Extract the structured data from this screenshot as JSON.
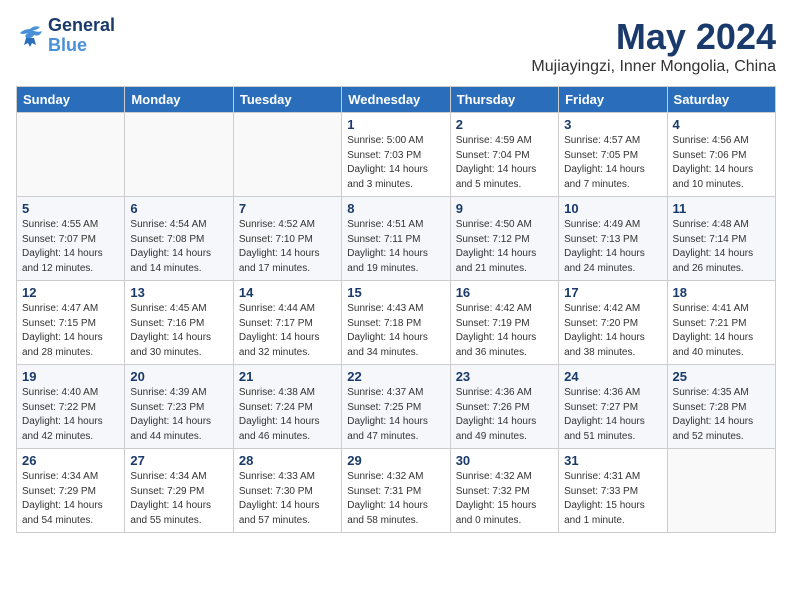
{
  "logo": {
    "line1": "General",
    "line2": "Blue"
  },
  "title": "May 2024",
  "subtitle": "Mujiayingzi, Inner Mongolia, China",
  "weekdays": [
    "Sunday",
    "Monday",
    "Tuesday",
    "Wednesday",
    "Thursday",
    "Friday",
    "Saturday"
  ],
  "rows": [
    [
      {
        "day": "",
        "info": ""
      },
      {
        "day": "",
        "info": ""
      },
      {
        "day": "",
        "info": ""
      },
      {
        "day": "1",
        "info": "Sunrise: 5:00 AM\nSunset: 7:03 PM\nDaylight: 14 hours\nand 3 minutes."
      },
      {
        "day": "2",
        "info": "Sunrise: 4:59 AM\nSunset: 7:04 PM\nDaylight: 14 hours\nand 5 minutes."
      },
      {
        "day": "3",
        "info": "Sunrise: 4:57 AM\nSunset: 7:05 PM\nDaylight: 14 hours\nand 7 minutes."
      },
      {
        "day": "4",
        "info": "Sunrise: 4:56 AM\nSunset: 7:06 PM\nDaylight: 14 hours\nand 10 minutes."
      }
    ],
    [
      {
        "day": "5",
        "info": "Sunrise: 4:55 AM\nSunset: 7:07 PM\nDaylight: 14 hours\nand 12 minutes."
      },
      {
        "day": "6",
        "info": "Sunrise: 4:54 AM\nSunset: 7:08 PM\nDaylight: 14 hours\nand 14 minutes."
      },
      {
        "day": "7",
        "info": "Sunrise: 4:52 AM\nSunset: 7:10 PM\nDaylight: 14 hours\nand 17 minutes."
      },
      {
        "day": "8",
        "info": "Sunrise: 4:51 AM\nSunset: 7:11 PM\nDaylight: 14 hours\nand 19 minutes."
      },
      {
        "day": "9",
        "info": "Sunrise: 4:50 AM\nSunset: 7:12 PM\nDaylight: 14 hours\nand 21 minutes."
      },
      {
        "day": "10",
        "info": "Sunrise: 4:49 AM\nSunset: 7:13 PM\nDaylight: 14 hours\nand 24 minutes."
      },
      {
        "day": "11",
        "info": "Sunrise: 4:48 AM\nSunset: 7:14 PM\nDaylight: 14 hours\nand 26 minutes."
      }
    ],
    [
      {
        "day": "12",
        "info": "Sunrise: 4:47 AM\nSunset: 7:15 PM\nDaylight: 14 hours\nand 28 minutes."
      },
      {
        "day": "13",
        "info": "Sunrise: 4:45 AM\nSunset: 7:16 PM\nDaylight: 14 hours\nand 30 minutes."
      },
      {
        "day": "14",
        "info": "Sunrise: 4:44 AM\nSunset: 7:17 PM\nDaylight: 14 hours\nand 32 minutes."
      },
      {
        "day": "15",
        "info": "Sunrise: 4:43 AM\nSunset: 7:18 PM\nDaylight: 14 hours\nand 34 minutes."
      },
      {
        "day": "16",
        "info": "Sunrise: 4:42 AM\nSunset: 7:19 PM\nDaylight: 14 hours\nand 36 minutes."
      },
      {
        "day": "17",
        "info": "Sunrise: 4:42 AM\nSunset: 7:20 PM\nDaylight: 14 hours\nand 38 minutes."
      },
      {
        "day": "18",
        "info": "Sunrise: 4:41 AM\nSunset: 7:21 PM\nDaylight: 14 hours\nand 40 minutes."
      }
    ],
    [
      {
        "day": "19",
        "info": "Sunrise: 4:40 AM\nSunset: 7:22 PM\nDaylight: 14 hours\nand 42 minutes."
      },
      {
        "day": "20",
        "info": "Sunrise: 4:39 AM\nSunset: 7:23 PM\nDaylight: 14 hours\nand 44 minutes."
      },
      {
        "day": "21",
        "info": "Sunrise: 4:38 AM\nSunset: 7:24 PM\nDaylight: 14 hours\nand 46 minutes."
      },
      {
        "day": "22",
        "info": "Sunrise: 4:37 AM\nSunset: 7:25 PM\nDaylight: 14 hours\nand 47 minutes."
      },
      {
        "day": "23",
        "info": "Sunrise: 4:36 AM\nSunset: 7:26 PM\nDaylight: 14 hours\nand 49 minutes."
      },
      {
        "day": "24",
        "info": "Sunrise: 4:36 AM\nSunset: 7:27 PM\nDaylight: 14 hours\nand 51 minutes."
      },
      {
        "day": "25",
        "info": "Sunrise: 4:35 AM\nSunset: 7:28 PM\nDaylight: 14 hours\nand 52 minutes."
      }
    ],
    [
      {
        "day": "26",
        "info": "Sunrise: 4:34 AM\nSunset: 7:29 PM\nDaylight: 14 hours\nand 54 minutes."
      },
      {
        "day": "27",
        "info": "Sunrise: 4:34 AM\nSunset: 7:29 PM\nDaylight: 14 hours\nand 55 minutes."
      },
      {
        "day": "28",
        "info": "Sunrise: 4:33 AM\nSunset: 7:30 PM\nDaylight: 14 hours\nand 57 minutes."
      },
      {
        "day": "29",
        "info": "Sunrise: 4:32 AM\nSunset: 7:31 PM\nDaylight: 14 hours\nand 58 minutes."
      },
      {
        "day": "30",
        "info": "Sunrise: 4:32 AM\nSunset: 7:32 PM\nDaylight: 15 hours\nand 0 minutes."
      },
      {
        "day": "31",
        "info": "Sunrise: 4:31 AM\nSunset: 7:33 PM\nDaylight: 15 hours\nand 1 minute."
      },
      {
        "day": "",
        "info": ""
      }
    ]
  ]
}
